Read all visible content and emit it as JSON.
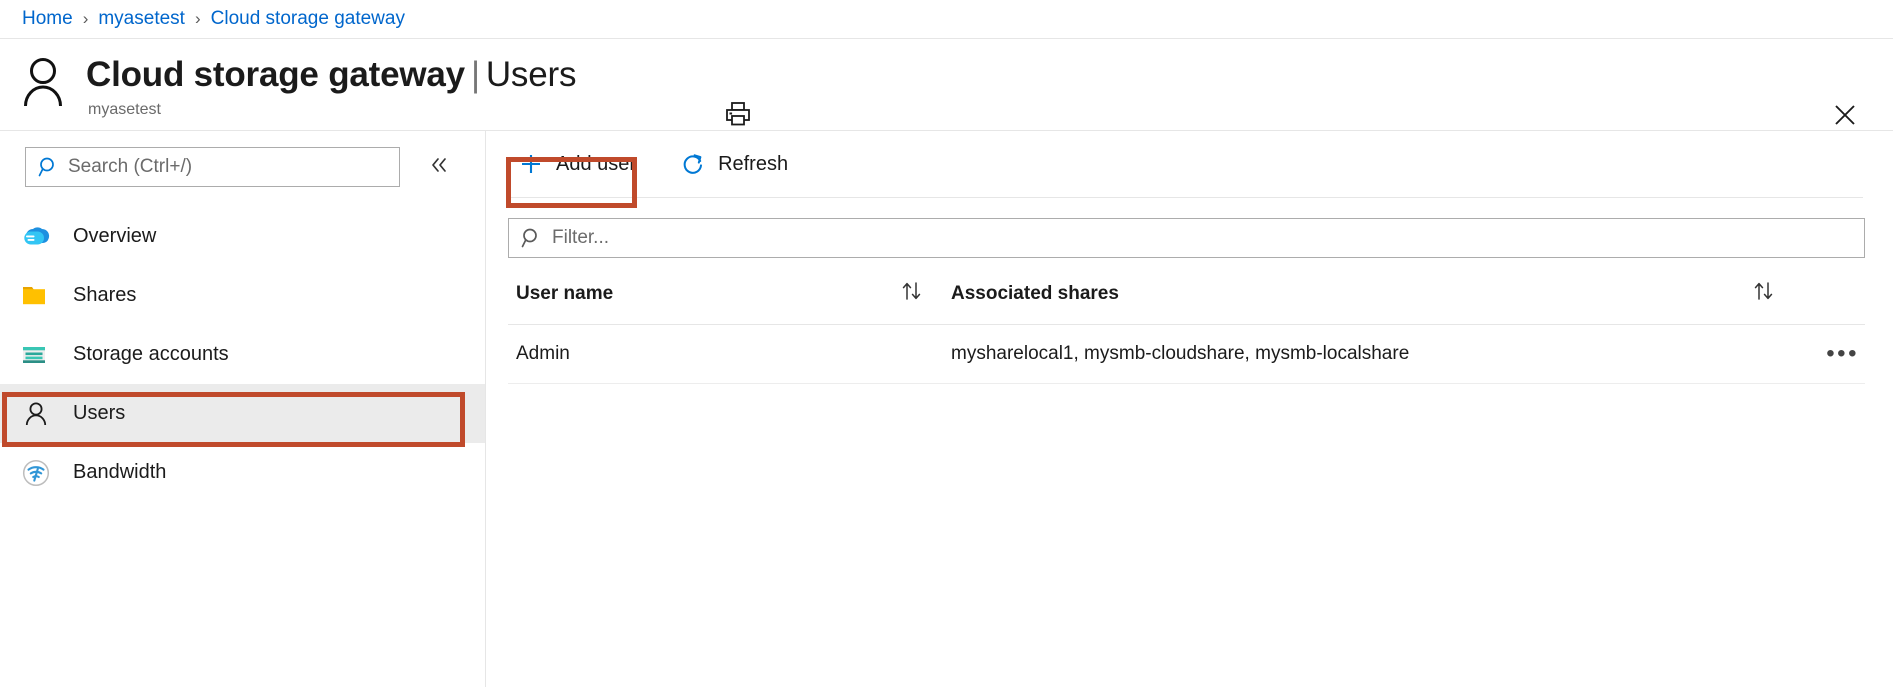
{
  "breadcrumb": {
    "items": [
      {
        "label": "Home"
      },
      {
        "label": "myasetest"
      },
      {
        "label": "Cloud storage gateway"
      }
    ],
    "separator": "›"
  },
  "header": {
    "icon": "user-outline-icon",
    "title_main": "Cloud storage gateway",
    "title_separator": "|",
    "title_section": "Users",
    "subtitle": "myasetest",
    "print_icon": "print-icon",
    "close_icon": "close-icon"
  },
  "sidebar": {
    "search": {
      "placeholder": "Search (Ctrl+/)",
      "value": "",
      "icon": "search-icon"
    },
    "collapse": {
      "icon": "chevron-double-left-icon",
      "glyph": "«"
    },
    "items": [
      {
        "label": "Overview",
        "icon": "cloud-icon",
        "selected": false
      },
      {
        "label": "Shares",
        "icon": "folder-icon",
        "selected": false
      },
      {
        "label": "Storage accounts",
        "icon": "storage-account-icon",
        "selected": false
      },
      {
        "label": "Users",
        "icon": "user-icon",
        "selected": true
      },
      {
        "label": "Bandwidth",
        "icon": "bandwidth-wifi-icon",
        "selected": false
      }
    ]
  },
  "toolbar": {
    "add_user_label": "Add user",
    "add_user_icon": "plus-icon",
    "refresh_label": "Refresh",
    "refresh_icon": "refresh-icon"
  },
  "filter": {
    "placeholder": "Filter...",
    "value": "",
    "icon": "search-icon"
  },
  "table": {
    "columns": [
      {
        "label": "User name",
        "sortable": true,
        "sort_icon": "sort-arrows-icon"
      },
      {
        "label": "Associated shares",
        "sortable": true,
        "sort_icon": "sort-arrows-icon"
      }
    ],
    "rows": [
      {
        "user_name": "Admin",
        "associated_shares": "mysharelocal1, mysmb-cloudshare, mysmb-localshare",
        "menu_icon": "ellipsis-icon",
        "menu_glyph": "•••"
      }
    ]
  },
  "annotations": {
    "color": "#c04a2b",
    "boxes": [
      {
        "target": "add-user-button"
      },
      {
        "target": "sidebar-item-users"
      }
    ]
  },
  "colors": {
    "link": "#0066cc",
    "accent_blue": "#0078d4",
    "cloud_icon": "#2fbdf1",
    "folder_icon": "#ffc000",
    "storage_icon": "#30c3b0",
    "selected_bg": "#ebebeb",
    "annotation_red": "#c04a2b"
  }
}
